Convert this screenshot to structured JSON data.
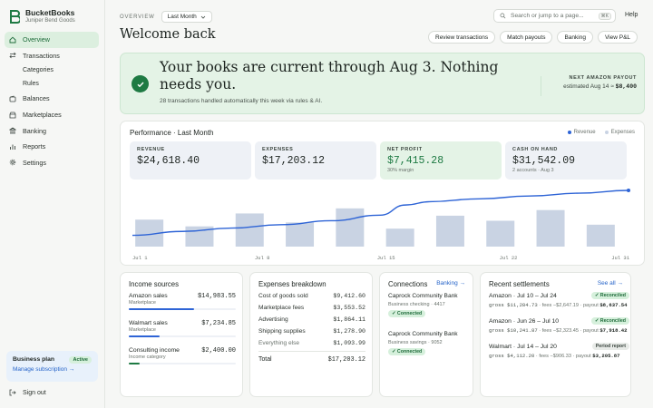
{
  "brand": {
    "name": "BucketBooks",
    "company": "Juniper Bend Goods"
  },
  "sidebar": {
    "items": [
      {
        "label": "Overview",
        "icon": "home-icon",
        "active": true
      },
      {
        "label": "Transactions",
        "icon": "transfer-icon"
      },
      {
        "label": "Categories",
        "sub": true
      },
      {
        "label": "Rules",
        "sub": true
      },
      {
        "label": "Balances",
        "icon": "wallet-icon"
      },
      {
        "label": "Marketplaces",
        "icon": "store-icon"
      },
      {
        "label": "Banking",
        "icon": "bank-icon"
      },
      {
        "label": "Reports",
        "icon": "bar-chart-icon"
      },
      {
        "label": "Settings",
        "icon": "gear-icon"
      }
    ],
    "plan": {
      "title": "Business plan",
      "status": "Active",
      "link": "Manage subscription →"
    },
    "signout": "Sign out"
  },
  "header": {
    "overview_label": "OVERVIEW",
    "period": "Last Month",
    "search_placeholder": "Search or jump to a page...",
    "shortcut": "⌘K",
    "help": "Help",
    "welcome": "Welcome back",
    "actions": [
      "Review transactions",
      "Match payouts",
      "Banking",
      "View P&L"
    ]
  },
  "hero": {
    "title": "Your books are current through Aug 3. Nothing needs you.",
    "subtitle": "28 transactions handled automatically this week via rules & AI.",
    "payout_label": "NEXT AMAZON PAYOUT",
    "payout_prefix": "estimated Aug 14 ≈",
    "payout_value": "$8,400"
  },
  "performance": {
    "title": "Performance · Last Month",
    "legend_revenue": "Revenue",
    "legend_costs": "Expenses",
    "kpis": [
      {
        "label": "REVENUE",
        "value": "$24,618.40",
        "note": ""
      },
      {
        "label": "EXPENSES",
        "value": "$17,203.12",
        "note": ""
      },
      {
        "label": "NET PROFIT",
        "value": "$7,415.28",
        "note": "30% margin"
      },
      {
        "label": "CASH ON HAND",
        "value": "$31,542.09",
        "note": "2 accounts · Aug 3"
      }
    ]
  },
  "chart_data": {
    "type": "bar",
    "x_ticks": [
      "Jul 1",
      "Jul 8",
      "Jul 15",
      "Jul 22",
      "Jul 31"
    ],
    "series": [
      {
        "name": "Expenses",
        "values": [
          0.48,
          0.36,
          0.59,
          0.43,
          0.68,
          0.32,
          0.55,
          0.46,
          0.65,
          0.39
        ]
      },
      {
        "name": "Revenue",
        "x": [
          0,
          0.1,
          0.2,
          0.3,
          0.4,
          0.5,
          0.55,
          0.6,
          0.7,
          0.8,
          0.9,
          1.0
        ],
        "values": [
          0.2,
          0.27,
          0.33,
          0.39,
          0.46,
          0.56,
          0.74,
          0.8,
          0.85,
          0.9,
          0.95,
          1.0
        ]
      }
    ],
    "colors": {
      "revenue": "#2e64d6",
      "expenses": "#c9d3e3"
    },
    "grid": false
  },
  "income": {
    "title": "Income sources",
    "rows": [
      {
        "name": "Amazon sales",
        "sub": "Marketplace",
        "amount": "$14,983.55",
        "share": 0.61,
        "color": "#2e64d6"
      },
      {
        "name": "Walmart sales",
        "sub": "Marketplace",
        "amount": "$7,234.85",
        "share": 0.29,
        "color": "#2e64d6"
      },
      {
        "name": "Consulting income",
        "sub": "Income category",
        "amount": "$2,400.00",
        "share": 0.1,
        "color": "#1e7a43"
      }
    ]
  },
  "expenses": {
    "title": "Expenses breakdown",
    "rows": [
      {
        "name": "Cost of goods sold",
        "amount": "$9,412.60"
      },
      {
        "name": "Marketplace fees",
        "amount": "$3,553.52"
      },
      {
        "name": "Advertising",
        "amount": "$1,864.11"
      },
      {
        "name": "Shipping supplies",
        "amount": "$1,278.90"
      },
      {
        "name": "Everything else",
        "amount": "$1,093.99"
      }
    ],
    "total_label": "Total",
    "total": "$17,203.12"
  },
  "connections": {
    "title": "Connections",
    "link": "Banking →",
    "items": [
      {
        "name": "Caprock Community Bank",
        "sub": "Business checking · 4417",
        "status": "✓ Connected"
      },
      {
        "name": "Caprock Community Bank",
        "sub": "Business savings · 9052",
        "status": "✓ Connected"
      }
    ]
  },
  "settlements": {
    "title": "Recent settlements",
    "link": "See all →",
    "items": [
      {
        "name": "Amazon · Jul 10 – Jul 24",
        "gross": "gross $11,284.73",
        "fees": "· fees −$2,647.19 · payout",
        "payout": "$8,637.54",
        "status": "✓ Reconciled"
      },
      {
        "name": "Amazon · Jun 26 – Jul 10",
        "gross": "gross $10,241.87",
        "fees": "· fees −$2,323.45 · payout",
        "payout": "$7,918.42",
        "status": "✓ Reconciled"
      },
      {
        "name": "Walmart · Jul 14 – Jul 20",
        "gross": "gross $4,112.20",
        "fees": "· fees −$906.33 · payout",
        "payout": "$3,205.87",
        "status": "Period report"
      }
    ]
  }
}
